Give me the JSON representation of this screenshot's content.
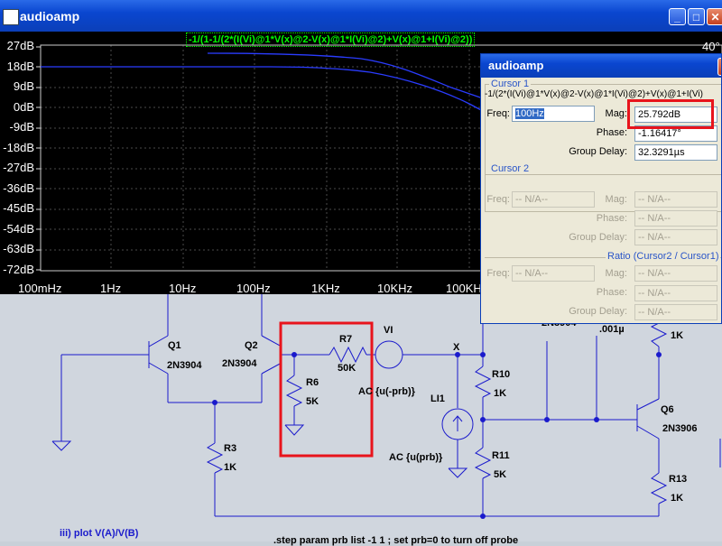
{
  "window": {
    "title": "audioamp",
    "min_label": "_",
    "max_label": "□",
    "close_label": "✕"
  },
  "plot": {
    "expression": "-1/(1-1/(2*(I(Vi)@1*V(x)@2-V(x)@1*I(Vi)@2)+V(x)@1+I(Vi)@2))",
    "y_ticks": [
      "27dB",
      "18dB",
      "9dB",
      "0dB",
      "-9dB",
      "-18dB",
      "-27dB",
      "-36dB",
      "-45dB",
      "-54dB",
      "-63dB",
      "-72dB"
    ],
    "x_ticks": [
      "100mHz",
      "1Hz",
      "10Hz",
      "100Hz",
      "1KHz",
      "10KHz",
      "100KHz"
    ],
    "right_axis_label": "40°",
    "colors": {
      "background": "#000000",
      "trace": "#2a3cff",
      "grid": "#4a4a4a"
    }
  },
  "dialog": {
    "title": "audioamp",
    "close_label": "✕",
    "cursor1": {
      "group_title": "Cursor 1",
      "expression": "-1/(2*(I(Vi)@1*V(x)@2-V(x)@1*I(Vi)@2)+V(x)@1+I(Vi)",
      "freq_label": "Freq:",
      "freq_value": "100Hz",
      "mag_label": "Mag:",
      "mag_value": "25.792dB",
      "phase_label": "Phase:",
      "phase_value": "-1.16417°",
      "gd_label": "Group Delay:",
      "gd_value": "32.3291µs"
    },
    "cursor2": {
      "group_title": "Cursor 2",
      "freq_label": "Freq:",
      "freq_value": "-- N/A--",
      "mag_label": "Mag:",
      "mag_value": "-- N/A--",
      "phase_label": "Phase:",
      "phase_value": "-- N/A--",
      "gd_label": "Group Delay:",
      "gd_value": "-- N/A--"
    },
    "ratio": {
      "group_title": "Ratio (Cursor2 / Cursor1)",
      "freq_label": "Freq:",
      "freq_value": "-- N/A--",
      "mag_label": "Mag:",
      "mag_value": "-- N/A--",
      "phase_label": "Phase:",
      "phase_value": "-- N/A--",
      "gd_label": "Group Delay:",
      "gd_value": "-- N/A--"
    }
  },
  "schematic": {
    "q1": "Q1",
    "q1_part": "2N3904",
    "q2": "Q2",
    "q2_part": "2N3904",
    "r7": "R7",
    "r7_val": "50K",
    "r6": "R6",
    "r6_val": "5K",
    "vi": "VI",
    "vi_spec": "AC {u(-prb)}",
    "x_node": "X",
    "r10": "R10",
    "r10_val": "1K",
    "li1": "LI1",
    "li1_spec": "AC {u(prb)}",
    "r11": "R11",
    "r11_val": "5K",
    "r3": "R3",
    "r3_val": "1K",
    "q6": "Q6",
    "q6_part": "2N3906",
    "r13": "R13",
    "r13_val": "1K",
    "r_top_val": "1K",
    "cap_val": ".001µ",
    "q_top_part": "2N3904",
    "note1": "iii) plot V(A)/V(B)",
    "note2": ".step param prb list -1 1 ; set prb=0 to turn off probe"
  }
}
